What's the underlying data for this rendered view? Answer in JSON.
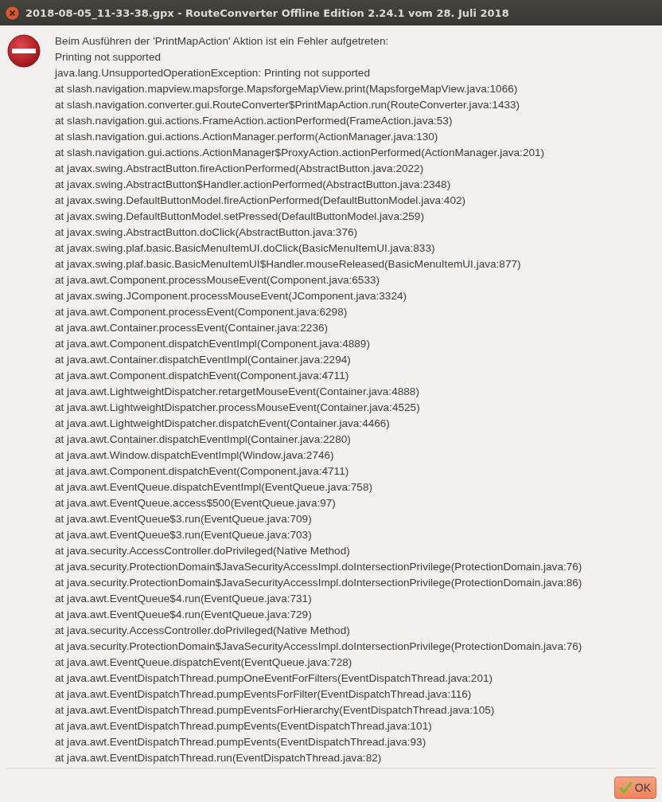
{
  "window": {
    "title": "2018-08-05_11-33-38.gpx - RouteConverter Offline Edition 2.24.1 vom 28. Juli 2018"
  },
  "message_lines": [
    "Beim Ausführen der 'PrintMapAction' Aktion ist ein Fehler aufgetreten:",
    "Printing not supported",
    "java.lang.UnsupportedOperationException: Printing not supported",
    "at slash.navigation.mapview.mapsforge.MapsforgeMapView.print(MapsforgeMapView.java:1066)",
    "at slash.navigation.converter.gui.RouteConverter$PrintMapAction.run(RouteConverter.java:1433)",
    "at slash.navigation.gui.actions.FrameAction.actionPerformed(FrameAction.java:53)",
    "at slash.navigation.gui.actions.ActionManager.perform(ActionManager.java:130)",
    "at slash.navigation.gui.actions.ActionManager$ProxyAction.actionPerformed(ActionManager.java:201)",
    "at javax.swing.AbstractButton.fireActionPerformed(AbstractButton.java:2022)",
    "at javax.swing.AbstractButton$Handler.actionPerformed(AbstractButton.java:2348)",
    "at javax.swing.DefaultButtonModel.fireActionPerformed(DefaultButtonModel.java:402)",
    "at javax.swing.DefaultButtonModel.setPressed(DefaultButtonModel.java:259)",
    "at javax.swing.AbstractButton.doClick(AbstractButton.java:376)",
    "at javax.swing.plaf.basic.BasicMenuItemUI.doClick(BasicMenuItemUI.java:833)",
    "at javax.swing.plaf.basic.BasicMenuItemUI$Handler.mouseReleased(BasicMenuItemUI.java:877)",
    "at java.awt.Component.processMouseEvent(Component.java:6533)",
    "at javax.swing.JComponent.processMouseEvent(JComponent.java:3324)",
    "at java.awt.Component.processEvent(Component.java:6298)",
    "at java.awt.Container.processEvent(Container.java:2236)",
    "at java.awt.Component.dispatchEventImpl(Component.java:4889)",
    "at java.awt.Container.dispatchEventImpl(Container.java:2294)",
    "at java.awt.Component.dispatchEvent(Component.java:4711)",
    "at java.awt.LightweightDispatcher.retargetMouseEvent(Container.java:4888)",
    "at java.awt.LightweightDispatcher.processMouseEvent(Container.java:4525)",
    "at java.awt.LightweightDispatcher.dispatchEvent(Container.java:4466)",
    "at java.awt.Container.dispatchEventImpl(Container.java:2280)",
    "at java.awt.Window.dispatchEventImpl(Window.java:2746)",
    "at java.awt.Component.dispatchEvent(Component.java:4711)",
    "at java.awt.EventQueue.dispatchEventImpl(EventQueue.java:758)",
    "at java.awt.EventQueue.access$500(EventQueue.java:97)",
    "at java.awt.EventQueue$3.run(EventQueue.java:709)",
    "at java.awt.EventQueue$3.run(EventQueue.java:703)",
    "at java.security.AccessController.doPrivileged(Native Method)",
    "at java.security.ProtectionDomain$JavaSecurityAccessImpl.doIntersectionPrivilege(ProtectionDomain.java:76)",
    "at java.security.ProtectionDomain$JavaSecurityAccessImpl.doIntersectionPrivilege(ProtectionDomain.java:86)",
    "at java.awt.EventQueue$4.run(EventQueue.java:731)",
    "at java.awt.EventQueue$4.run(EventQueue.java:729)",
    "at java.security.AccessController.doPrivileged(Native Method)",
    "at java.security.ProtectionDomain$JavaSecurityAccessImpl.doIntersectionPrivilege(ProtectionDomain.java:76)",
    "at java.awt.EventQueue.dispatchEvent(EventQueue.java:728)",
    "at java.awt.EventDispatchThread.pumpOneEventForFilters(EventDispatchThread.java:201)",
    "at java.awt.EventDispatchThread.pumpEventsForFilter(EventDispatchThread.java:116)",
    "at java.awt.EventDispatchThread.pumpEventsForHierarchy(EventDispatchThread.java:105)",
    "at java.awt.EventDispatchThread.pumpEvents(EventDispatchThread.java:101)",
    "at java.awt.EventDispatchThread.pumpEvents(EventDispatchThread.java:93)",
    "at java.awt.EventDispatchThread.run(EventDispatchThread.java:82)"
  ],
  "buttons": [
    {
      "label": "OK"
    }
  ]
}
